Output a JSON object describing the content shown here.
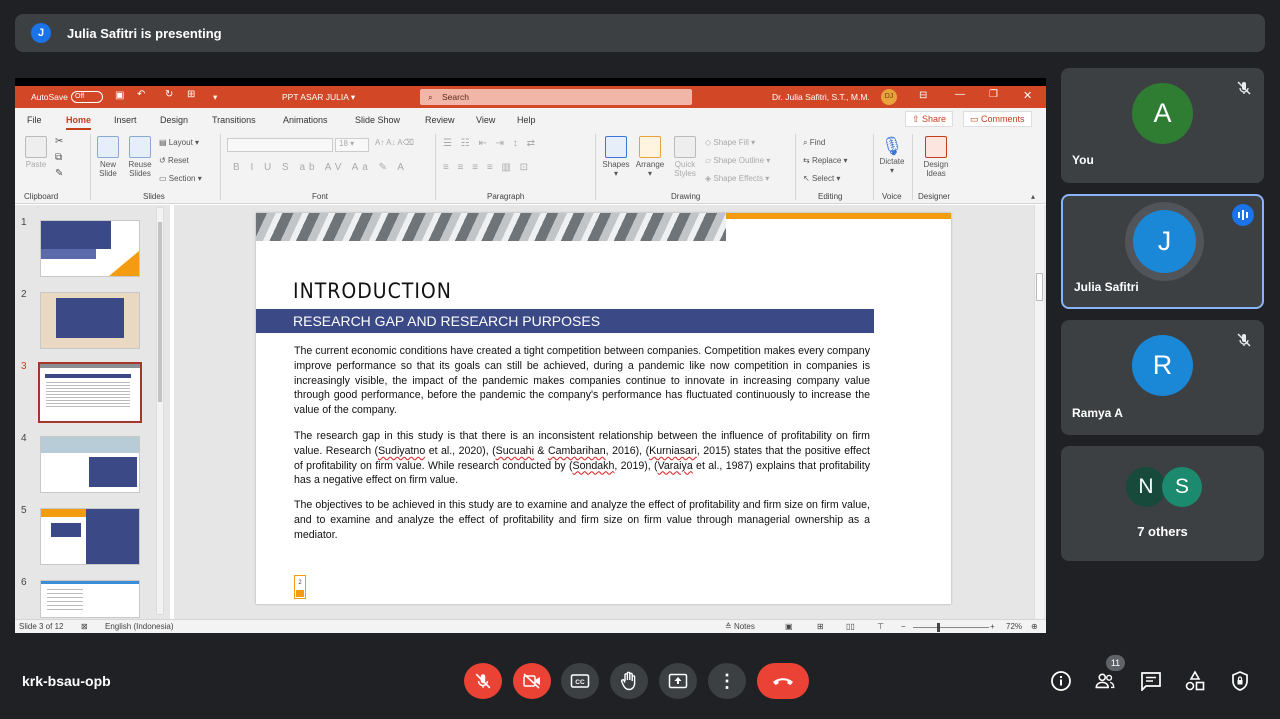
{
  "meeting": {
    "presenter_initial": "J",
    "presenter_text": "Julia Safitri is presenting",
    "meeting_code": "krk-bsau-opb",
    "participant_count": "11"
  },
  "ppt": {
    "autosave": "AutoSave",
    "autosave_state": "Off",
    "file_title": "PPT ASAR JULIA",
    "search": "Search",
    "user": "Dr. Julia Safitri, S.T., M.M.",
    "user_initials": "DJ",
    "menu": [
      "File",
      "Home",
      "Insert",
      "Design",
      "Transitions",
      "Animations",
      "Slide Show",
      "Review",
      "View",
      "Help"
    ],
    "share": "Share",
    "comments": "Comments",
    "ribbon": {
      "paste": "Paste",
      "new_slide": "New Slide",
      "reuse_slides": "Reuse Slides",
      "layout": "Layout",
      "reset": "Reset",
      "section": "Section",
      "font_size": "18",
      "shapes": "Shapes",
      "arrange": "Arrange",
      "quick_styles": "Quick Styles",
      "shape_fill": "Shape Fill",
      "shape_outline": "Shape Outline",
      "shape_effects": "Shape Effects",
      "find": "Find",
      "replace": "Replace",
      "select": "Select",
      "dictate": "Dictate",
      "design_ideas": "Design Ideas",
      "groups": [
        "Clipboard",
        "Slides",
        "Font",
        "Paragraph",
        "Drawing",
        "Editing",
        "Voice",
        "Designer"
      ]
    },
    "thumbnails": [
      "1",
      "2",
      "3",
      "4",
      "5",
      "6"
    ],
    "slide": {
      "heading": "INTRODUCTION",
      "subheading": "RESEARCH GAP AND RESEARCH PURPOSES",
      "p1": "The current economic conditions have created a tight competition between companies. Competition makes every company improve performance so that its goals can still be achieved, during a pandemic like now competition in companies is increasingly visible, the impact of the pandemic makes companies continue to innovate in increasing company value through good performance, before the pandemic the company's performance has fluctuated continuously to increase the value of the company.",
      "p2_a": "The research gap in this study is that there is an inconsistent relationship between the influence of profitability on firm value. Research (",
      "p2_b": "Sudiyatno",
      "p2_c": " et al., 2020), (",
      "p2_d": "Sucuahi",
      "p2_e": " & ",
      "p2_f": "Cambarihan",
      "p2_g": ", 2016), (",
      "p2_h": "Kurniasari",
      "p2_i": ", 2015) states that the positive effect of profitability on firm value. While research conducted by (",
      "p2_j": "Sondakh",
      "p2_k": ", 2019), (",
      "p2_l": "Varaiya",
      "p2_m": " et al., 1987) explains that profitability has a negative effect on firm value.",
      "p3": "The objectives to be achieved in this study are to examine and analyze the effect of profitability and firm size on firm value, and to examine and analyze the effect of profitability and firm size on firm value through managerial ownership as a mediator.",
      "page_number": "2"
    },
    "status": {
      "slide": "Slide 3 of 12",
      "language": "English (Indonesia)",
      "notes": "Notes",
      "zoom": "72%"
    }
  },
  "participants": [
    {
      "initial": "A",
      "name": "You",
      "color": "#2e7d32"
    },
    {
      "initial": "J",
      "name": "Julia Safitri",
      "color": "#1a88d6"
    },
    {
      "initial": "R",
      "name": "Ramya A",
      "color": "#1a88d6"
    },
    {
      "initial_1": "N",
      "initial_2": "S",
      "name": "7 others",
      "color_1": "#174a3a",
      "color_2": "#1b8a6e"
    }
  ]
}
